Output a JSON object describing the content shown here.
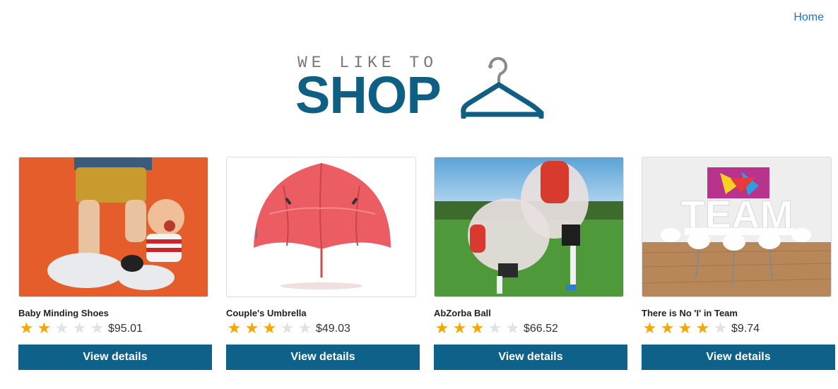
{
  "nav": {
    "home_label": "Home"
  },
  "logo": {
    "tagline": "WE LIKE TO",
    "wordmark": "SHOP"
  },
  "colors": {
    "brand": "#0f5f84",
    "button": "#0e6188",
    "star": "#f6a600",
    "link": "#1a73c8"
  },
  "products": [
    {
      "name": "Baby Minding Shoes",
      "rating": 2,
      "max_rating": 5,
      "price": "$95.01",
      "button": "View details"
    },
    {
      "name": "Couple's Umbrella",
      "rating": 3,
      "max_rating": 5,
      "price": "$49.03",
      "button": "View details"
    },
    {
      "name": "AbZorba Ball",
      "rating": 3,
      "max_rating": 5,
      "price": "$66.52",
      "button": "View details"
    },
    {
      "name": "There is No 'I' in Team",
      "rating": 4,
      "max_rating": 5,
      "price": "$9.74",
      "button": "View details"
    }
  ]
}
